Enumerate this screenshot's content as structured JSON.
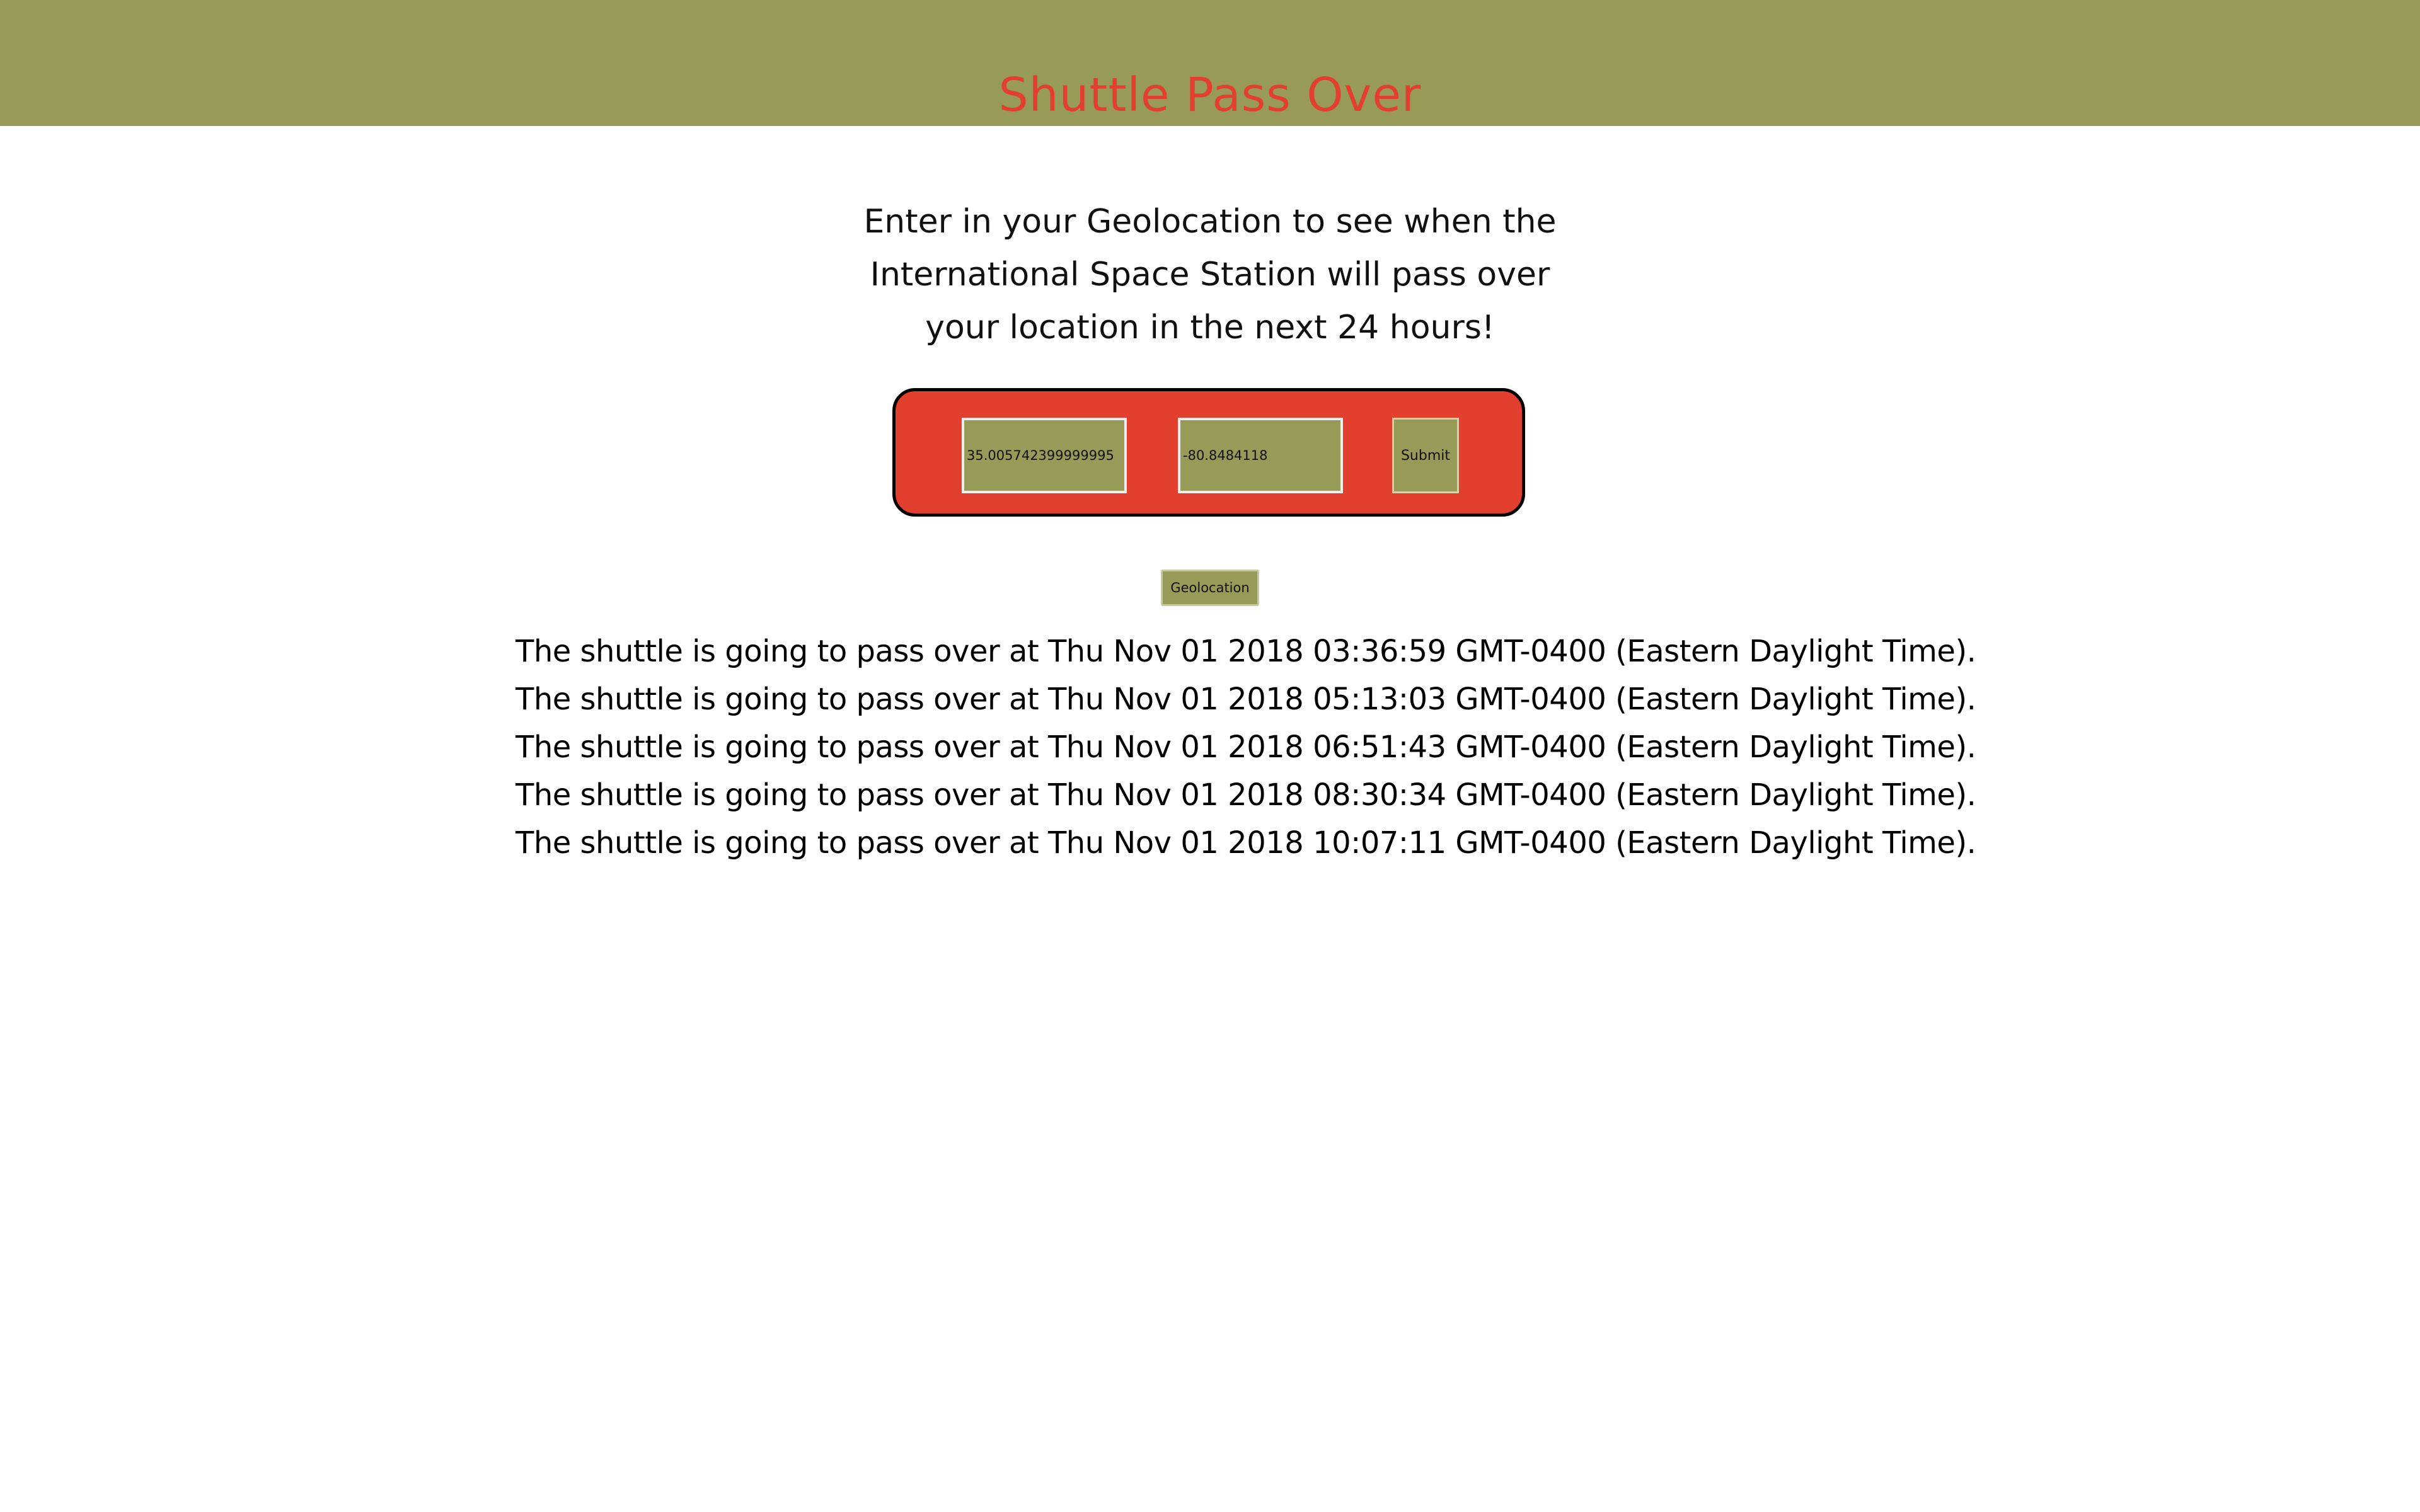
{
  "header": {
    "title": "Shuttle Pass Over",
    "background_color": "#989a57",
    "title_color": "#e23f2f"
  },
  "intro": {
    "text": "Enter in your Geolocation to see when the International Space Station will pass over your location in the next 24 hours!"
  },
  "form": {
    "panel_color": "#e23f2f",
    "latitude_value": "35.005742399999995",
    "longitude_value": "-80.8484118",
    "submit_label": "Submit"
  },
  "geolocation_button": {
    "label": "Geolocation"
  },
  "results": [
    {
      "text": "The shuttle is going to pass over at Thu Nov 01 2018 03:36:59 GMT-0400 (Eastern Daylight Time)."
    },
    {
      "text": "The shuttle is going to pass over at Thu Nov 01 2018 05:13:03 GMT-0400 (Eastern Daylight Time)."
    },
    {
      "text": "The shuttle is going to pass over at Thu Nov 01 2018 06:51:43 GMT-0400 (Eastern Daylight Time)."
    },
    {
      "text": "The shuttle is going to pass over at Thu Nov 01 2018 08:30:34 GMT-0400 (Eastern Daylight Time)."
    },
    {
      "text": "The shuttle is going to pass over at Thu Nov 01 2018 10:07:11 GMT-0400 (Eastern Daylight Time)."
    }
  ]
}
